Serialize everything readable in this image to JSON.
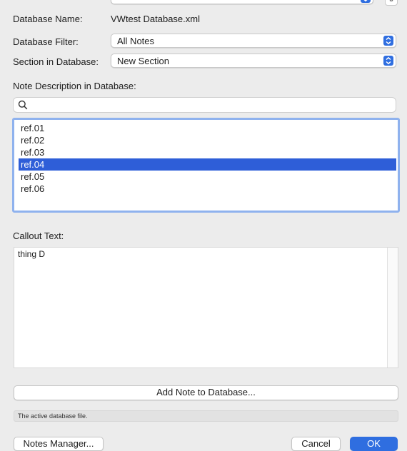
{
  "database": {
    "name_label": "Database Name:",
    "name_value": "VWtest Database.xml",
    "filter_label": "Database Filter:",
    "filter_value": "All Notes",
    "section_label": "Section in Database:",
    "section_value": "New Section"
  },
  "notes": {
    "description_label": "Note Description in Database:",
    "search_placeholder": "",
    "items": [
      "ref.01",
      "ref.02",
      "ref.03",
      "ref.04",
      "ref.05",
      "ref.06"
    ],
    "selected": "ref.04"
  },
  "callout": {
    "label": "Callout Text:",
    "text": "thing D"
  },
  "buttons": {
    "add_note": "Add Note to Database...",
    "notes_manager": "Notes Manager...",
    "cancel": "Cancel",
    "ok": "OK"
  },
  "status": {
    "text": "The active database file."
  },
  "colors": {
    "accent": "#2f6ee0",
    "selection": "#2e5ed8",
    "focus_ring": "#8fb2ee"
  }
}
